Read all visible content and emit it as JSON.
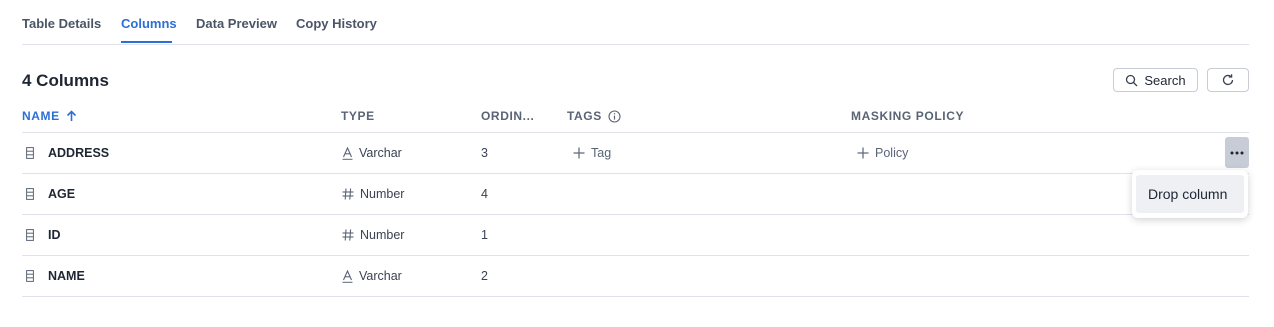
{
  "tabs": [
    {
      "label": "Table Details",
      "active": false
    },
    {
      "label": "Columns",
      "active": true
    },
    {
      "label": "Data Preview",
      "active": false
    },
    {
      "label": "Copy History",
      "active": false
    }
  ],
  "header": {
    "title": "4 Columns",
    "search_label": "Search"
  },
  "table": {
    "columns": {
      "name": "NAME",
      "type": "TYPE",
      "ordinal": "ORDIN...",
      "tags": "TAGS",
      "masking_policy": "MASKING POLICY"
    },
    "sort": {
      "column": "NAME",
      "direction": "ascending"
    },
    "rows": [
      {
        "name": "ADDRESS",
        "type": "Varchar",
        "type_icon": "text-type-icon",
        "ordinal": "3",
        "tag_action": "Tag",
        "policy_action": "Policy"
      },
      {
        "name": "AGE",
        "type": "Number",
        "type_icon": "hash-icon",
        "ordinal": "4"
      },
      {
        "name": "ID",
        "type": "Number",
        "type_icon": "hash-icon",
        "ordinal": "1"
      },
      {
        "name": "NAME",
        "type": "Varchar",
        "type_icon": "text-type-icon",
        "ordinal": "2"
      }
    ]
  },
  "row_menu": {
    "items": [
      "Drop column"
    ]
  },
  "colors": {
    "accent": "#2c6fd6",
    "text": "#1e2533",
    "muted": "#5a6475",
    "border": "#dfe2e8"
  }
}
